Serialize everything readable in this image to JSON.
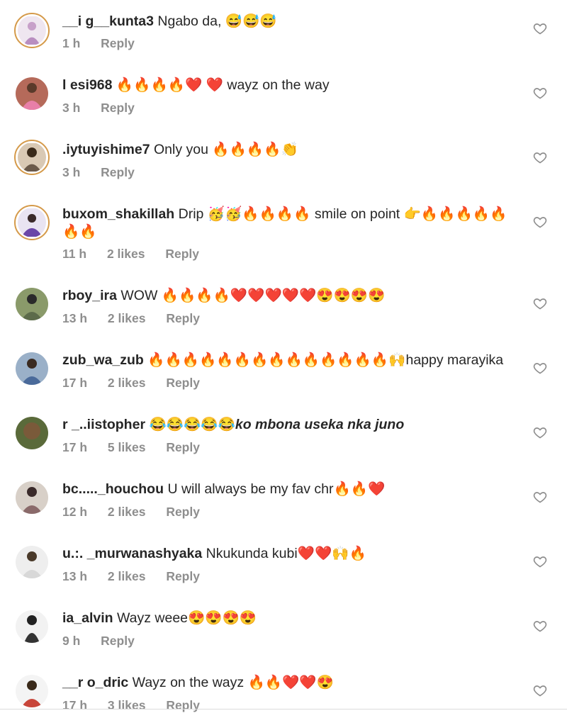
{
  "colors": {
    "text": "#262626",
    "meta": "#8e8e8e",
    "story_ring": "#d59a4a"
  },
  "comments": [
    {
      "username": "__i  g__kunta3",
      "text": "Ngabo da, 😅😅😅",
      "time": "1 h",
      "likes": "",
      "reply": "Reply",
      "story_ring": true,
      "avatar_color": "#c7a0c9"
    },
    {
      "username": "l     esi968",
      "text": "🔥🔥🔥🔥❤️ ❤️ wayz on the way",
      "time": "3 h",
      "likes": "",
      "reply": "Reply",
      "story_ring": false,
      "avatar_color": "#e87fa8"
    },
    {
      "username": "  .iytuyishime7",
      "text": "Only you 🔥🔥🔥🔥👏",
      "time": "3 h",
      "likes": "",
      "reply": "Reply",
      "story_ring": true,
      "avatar_color": "#6b5a4a"
    },
    {
      "username": "buxom_shakillah",
      "text": "Drip 🥳🥳🔥🔥🔥🔥 smile on point 👉🔥🔥🔥🔥🔥🔥🔥",
      "time": "11 h",
      "likes": "2 likes",
      "reply": "Reply",
      "story_ring": true,
      "avatar_color": "#6b47a8"
    },
    {
      "username": "        rboy_ira",
      "text": "WOW 🔥🔥🔥🔥❤️❤️❤️❤️❤️😍😍😍😍",
      "time": "13 h",
      "likes": "2 likes",
      "reply": "Reply",
      "story_ring": false,
      "avatar_color": "#5c6b4a"
    },
    {
      "username": "zub_wa_zub",
      "text": "🔥🔥🔥🔥🔥🔥🔥🔥🔥🔥🔥🔥🔥🔥🙌happy marayika",
      "time": "17 h",
      "likes": "2 likes",
      "reply": "Reply",
      "story_ring": false,
      "avatar_color": "#4a6a9a"
    },
    {
      "username": "r        _..iistopher",
      "text": "😂😂😂😂😂",
      "text_italic": "ko mbona useka nka juno",
      "time": "17 h",
      "likes": "5 likes",
      "reply": "Reply",
      "story_ring": false,
      "avatar_color": "#7a5a3a"
    },
    {
      "username": "bc....._houchou",
      "text": "U will always be my fav chr🔥🔥❤️",
      "time": "12 h",
      "likes": "2 likes",
      "reply": "Reply",
      "story_ring": false,
      "avatar_color": "#8a6a6a"
    },
    {
      "username": "u.:.      _murwanashyaka",
      "text": "Nkukunda kubi❤️❤️🙌🔥",
      "time": "13 h",
      "likes": "2 likes",
      "reply": "Reply",
      "story_ring": false,
      "avatar_color": "#d8d8d8"
    },
    {
      "username": "      ia_alvin",
      "text": "Wayz weee😍😍😍😍",
      "time": "9 h",
      "likes": "",
      "reply": "Reply",
      "story_ring": false,
      "avatar_color": "#333333"
    },
    {
      "username": "__r      o_dric",
      "text": "Wayz on the wayz 🔥🔥❤️❤️😍",
      "time": "17 h",
      "likes": "3 likes",
      "reply": "Reply",
      "story_ring": false,
      "avatar_color": "#c8463a"
    }
  ]
}
